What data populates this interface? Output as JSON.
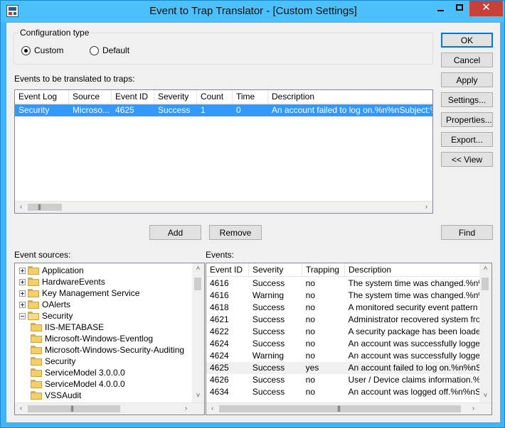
{
  "window": {
    "title": "Event to Trap Translator - [Custom Settings]",
    "controls": {
      "close": "✕"
    }
  },
  "config": {
    "label": "Configuration type",
    "options": [
      {
        "label": "Custom",
        "checked": true
      },
      {
        "label": "Default",
        "checked": false
      }
    ]
  },
  "events_translated": {
    "label": "Events to be translated to traps:",
    "columns": [
      "Event Log",
      "Source",
      "Event ID",
      "Severity",
      "Count",
      "Time",
      "Description"
    ],
    "rows": [
      [
        "Security",
        "Microso...",
        "4625",
        "Success",
        "1",
        "0",
        "An account failed to log on.%n%nSubject:%n%t"
      ]
    ]
  },
  "buttons": {
    "ok": "OK",
    "cancel": "Cancel",
    "apply": "Apply",
    "settings": "Settings...",
    "properties": "Properties...",
    "export": "Export...",
    "view": "<< View",
    "add": "Add",
    "remove": "Remove",
    "find": "Find"
  },
  "event_sources": {
    "label": "Event sources:",
    "items": [
      {
        "label": "Application",
        "level": 0,
        "expander": "plus"
      },
      {
        "label": "HardwareEvents",
        "level": 0,
        "expander": "plus"
      },
      {
        "label": "Key Management Service",
        "level": 0,
        "expander": "plus"
      },
      {
        "label": "OAlerts",
        "level": 0,
        "expander": "plus"
      },
      {
        "label": "Security",
        "level": 0,
        "expander": "minus"
      },
      {
        "label": "IIS-METABASE",
        "level": 1,
        "expander": ""
      },
      {
        "label": "Microsoft-Windows-Eventlog",
        "level": 1,
        "expander": ""
      },
      {
        "label": "Microsoft-Windows-Security-Auditing",
        "level": 1,
        "expander": ""
      },
      {
        "label": "Security",
        "level": 1,
        "expander": ""
      },
      {
        "label": "ServiceModel 3.0.0.0",
        "level": 1,
        "expander": ""
      },
      {
        "label": "ServiceModel 4.0.0.0",
        "level": 1,
        "expander": ""
      },
      {
        "label": "VSSAudit",
        "level": 1,
        "expander": ""
      }
    ]
  },
  "events": {
    "label": "Events:",
    "columns": [
      "Event ID",
      "Severity",
      "Trapping",
      "Description"
    ],
    "rows": [
      [
        "4616",
        "Success",
        "no",
        "The system time was changed.%n%nSubject:"
      ],
      [
        "4616",
        "Warning",
        "no",
        "The system time was changed.%n%nSubject:"
      ],
      [
        "4618",
        "Success",
        "no",
        "A monitored security event pattern has occurred"
      ],
      [
        "4621",
        "Success",
        "no",
        "Administrator recovered system from CrashOnAudit"
      ],
      [
        "4622",
        "Success",
        "no",
        "A security package has been loaded by"
      ],
      [
        "4624",
        "Success",
        "no",
        "An account was successfully logged on"
      ],
      [
        "4624",
        "Warning",
        "no",
        "An account was successfully logged on"
      ],
      [
        "4625",
        "Success",
        "yes",
        "An account failed to log on.%n%nSubject:"
      ],
      [
        "4626",
        "Success",
        "no",
        "User / Device claims information.%n%nSubject:"
      ],
      [
        "4634",
        "Success",
        "no",
        "An account was logged off.%n%nSubject:"
      ]
    ],
    "highlight_row": 7
  },
  "icons": {
    "scroll_left": "‹",
    "scroll_right": "›",
    "scroll_up": "˄",
    "scroll_down": "˅",
    "grip": "|||"
  }
}
